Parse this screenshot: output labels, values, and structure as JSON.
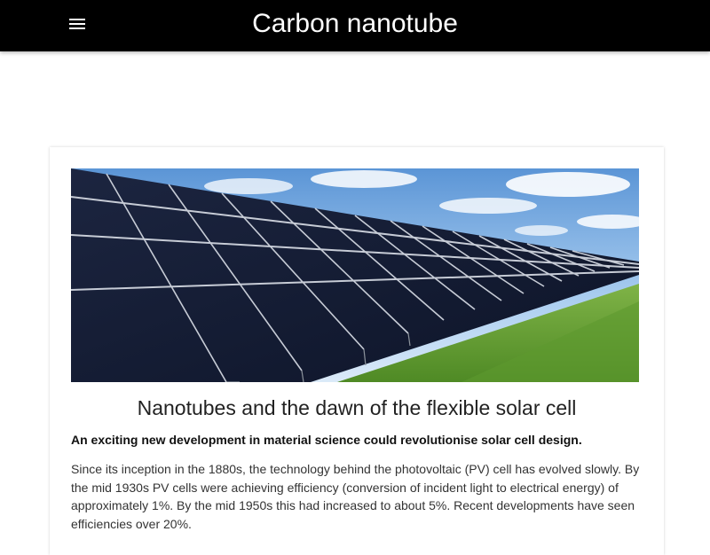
{
  "header": {
    "menu_icon": "hamburger-menu-icon",
    "title": "Carbon nanotube",
    "background": "#000000",
    "text_color": "#ffffff"
  },
  "article": {
    "image": "solar-panel-array-photo",
    "headline": "Nanotubes and the dawn of the flexible solar cell",
    "lead": "An exciting new development in material science could revolutionise solar cell design.",
    "body": "Since its inception in the 1880s, the technology behind the photovoltaic (PV) cell has evolved slowly. By the mid 1930s PV cells were achieving efficiency (conversion of incident light to electrical energy) of approximately 1%. By the mid 1950s this had increased to about 5%. Recent developments have seen efficiencies over 20%."
  }
}
